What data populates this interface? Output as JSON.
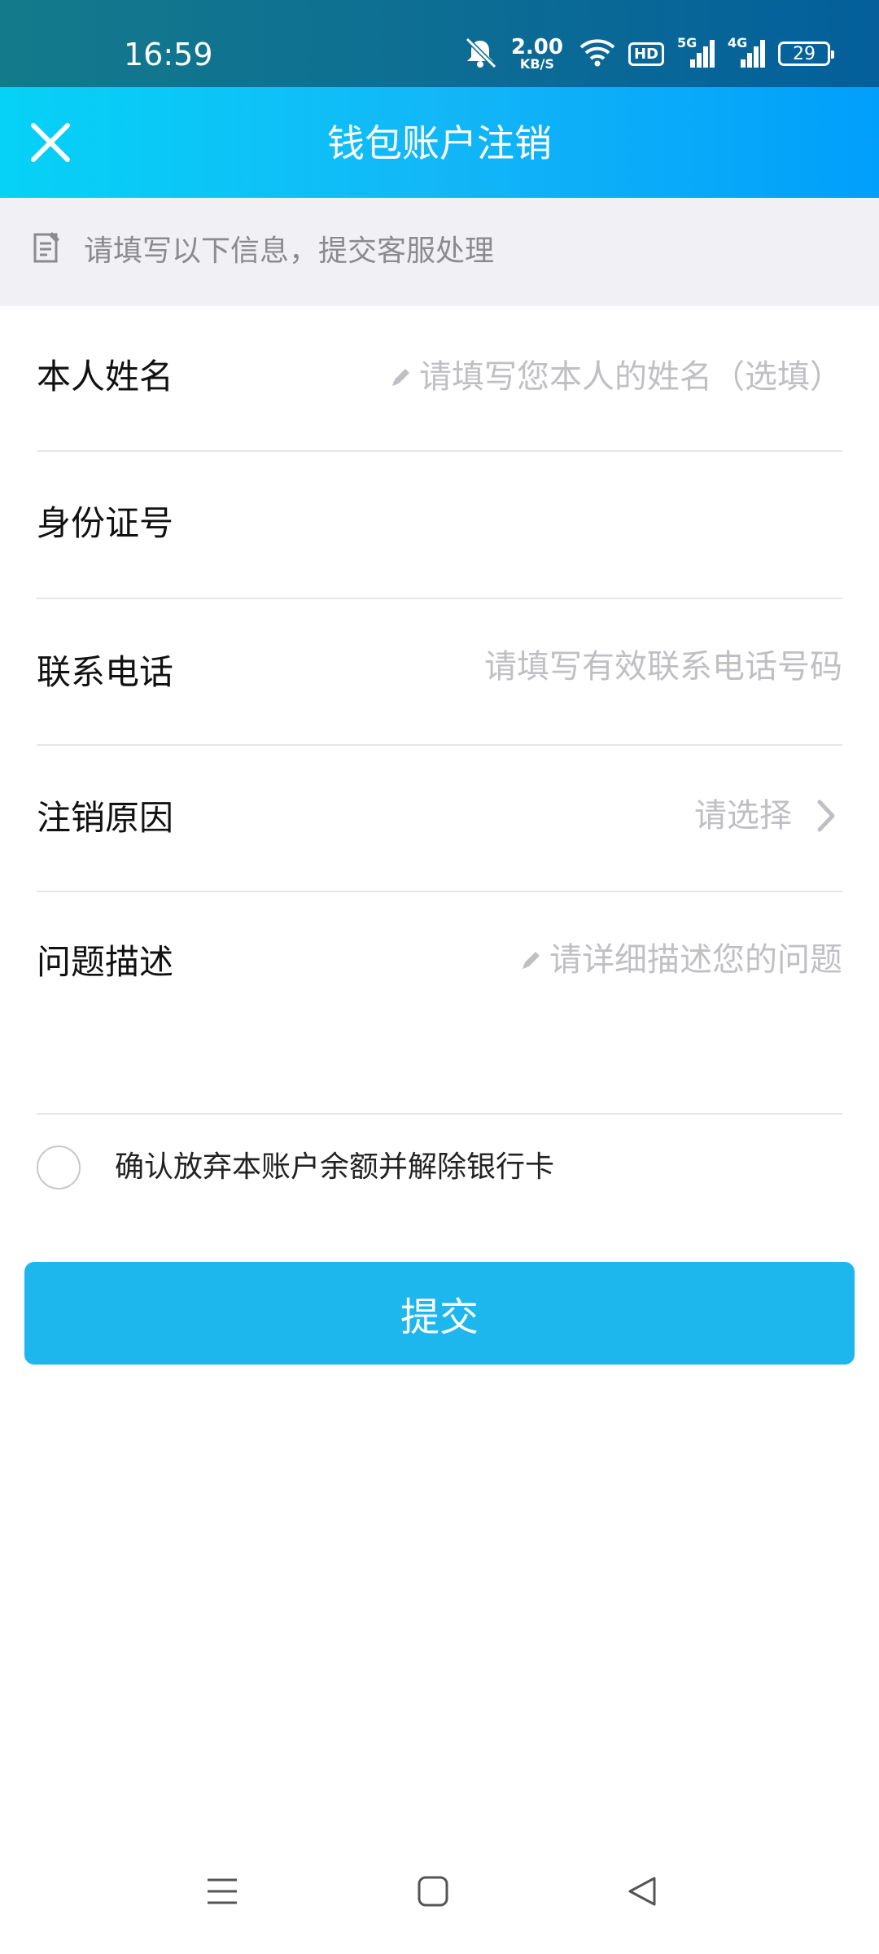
{
  "status_bar": {
    "time": "16:59",
    "net_speed_value": "2.00",
    "net_speed_unit": "KB/S",
    "hd_label": "HD",
    "sim1_label": "5G",
    "sim2_label": "4G",
    "battery": "29",
    "icons": [
      "mute-icon",
      "wifi-icon",
      "hd-icon",
      "signal-5g-icon",
      "signal-4g-icon",
      "battery-icon"
    ]
  },
  "header": {
    "title": "钱包账户注销",
    "close_icon": "close-icon"
  },
  "notice": {
    "icon": "form-icon",
    "text": "请填写以下信息，提交客服处理"
  },
  "form": {
    "name": {
      "label": "本人姓名",
      "placeholder": "请填写您本人的姓名（选填）"
    },
    "id_number": {
      "label": "身份证号",
      "placeholder": ""
    },
    "phone": {
      "label": "联系电话",
      "placeholder": "请填写有效联系电话号码"
    },
    "reason": {
      "label": "注销原因",
      "placeholder": "请选择"
    },
    "description": {
      "label": "问题描述",
      "placeholder": "请详细描述您的问题"
    }
  },
  "confirm": {
    "text": "确认放弃本账户余额并解除银行卡",
    "checked": false
  },
  "submit": {
    "label": "提交"
  },
  "colors": {
    "header_start": "#06d2f7",
    "header_end": "#019ffb",
    "submit_bg": "#1db7ee",
    "placeholder": "#c0c0c4"
  },
  "nav": {
    "icons": [
      "menu-icon",
      "home-icon",
      "back-icon"
    ]
  }
}
